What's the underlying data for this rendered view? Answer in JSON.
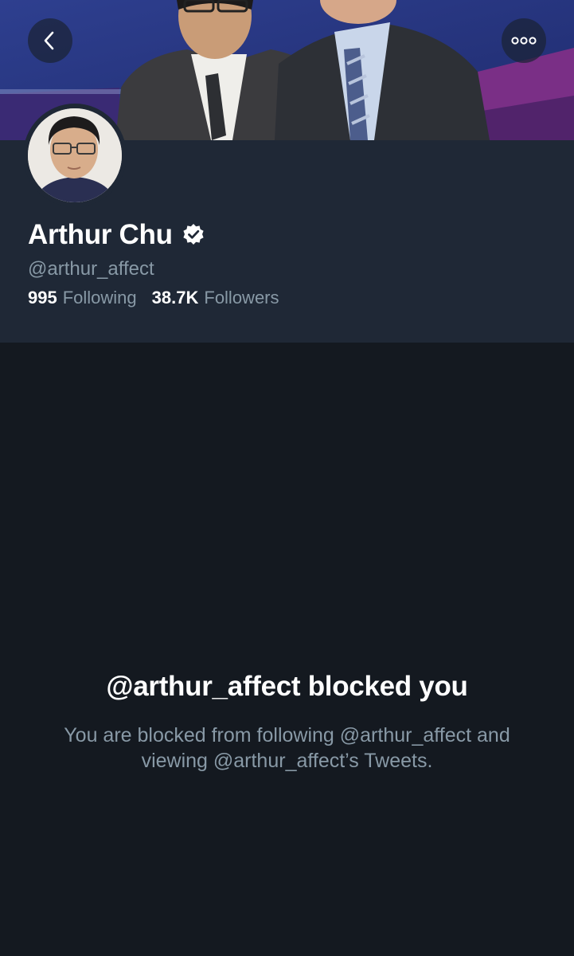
{
  "header": {
    "back_icon": "chevron-left-icon",
    "more_icon": "more-dots-icon"
  },
  "profile": {
    "display_name": "Arthur Chu",
    "verified_icon": "verified-badge-icon",
    "handle": "@arthur_affect",
    "following_count": "995",
    "following_label": "Following",
    "followers_count": "38.7K",
    "followers_label": "Followers"
  },
  "blocked": {
    "title": "@arthur_affect blocked you",
    "description": "You are blocked from following @arthur_affect and viewing @arthur_affect’s Tweets."
  },
  "colors": {
    "background": "#141920",
    "header_background": "#1f2836",
    "secondary_text": "#8899a6",
    "primary_text": "#ffffff"
  }
}
